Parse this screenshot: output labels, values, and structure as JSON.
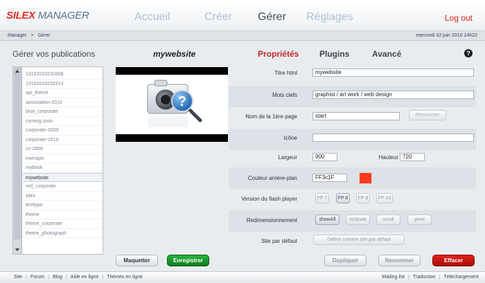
{
  "app": {
    "logo_part1": "SILEX",
    "logo_part2": "MANAGER"
  },
  "nav": {
    "home": "Accueil",
    "create": "Créer",
    "manage": "Gérer",
    "settings": "Réglages",
    "logout": "Log out"
  },
  "breadcrumb": {
    "root": "Manager",
    "sep": ">",
    "current": "Gérer"
  },
  "date": "mercredi 02 juin 2010 14h22",
  "sidebar": {
    "title": "Gérer vos publications",
    "items": [
      "13102010232608",
      "13102010232914",
      "api_theme",
      "association-2010",
      "blue_corporate",
      "coming.soon",
      "corporate-2009",
      "corporate-2010",
      "cv-2009",
      "exemple",
      "mybook",
      "mywebsite",
      "red_corporate",
      "silex",
      "testtypo",
      "theme",
      "theme_corporate",
      "theme_photograph"
    ],
    "selected_index": 11
  },
  "site": {
    "name": "mywebsite"
  },
  "tabs": {
    "properties": "Propriétés",
    "plugins": "Plugins",
    "advanced": "Avancé",
    "help": "?"
  },
  "props": {
    "html_title_label": "Titre html",
    "html_title_value": "mywebsite",
    "keywords_label": "Mots clefs",
    "keywords_value": "graphist / art work / web design",
    "first_page_label": "Nom de la 1ère page",
    "first_page_value": "start",
    "rename_label": "Renommer",
    "icon_label": "Icône",
    "icon_value": "",
    "width_label": "Largeur",
    "width_value": "900",
    "height_label": "Hauteur",
    "height_value": "720",
    "bg_color_label": "Couleur arrière-plan",
    "bg_color_value": "FF3c1F",
    "flash_label": "Version du flash player",
    "flash_options": [
      "FP 7",
      "FP 8",
      "FP 9",
      "FP 10"
    ],
    "flash_selected": 1,
    "resize_label": "Redimensionnement",
    "resize_options": [
      "showAll",
      "noScale",
      "scroll",
      "pixel"
    ],
    "resize_selected": 0,
    "default_site_label": "Site par défaut",
    "default_site_button": "Définir comme site par défaut"
  },
  "actions": {
    "mockup": "Maquetter",
    "save": "Enregistrer",
    "duplicate": "Dupliquer",
    "rename": "Renommer",
    "delete": "Effacer"
  },
  "footer": {
    "links_left": [
      "Site",
      "Forum",
      "Blog",
      "Aide en ligne",
      "Thèmes en ligne"
    ],
    "links_right": [
      "Mailing list",
      "Traduction",
      "Téléchargement"
    ]
  },
  "colors": {
    "accent_red": "#e0201a",
    "swatch": "#ff3c1f",
    "save_green": "#1a9a2c"
  }
}
